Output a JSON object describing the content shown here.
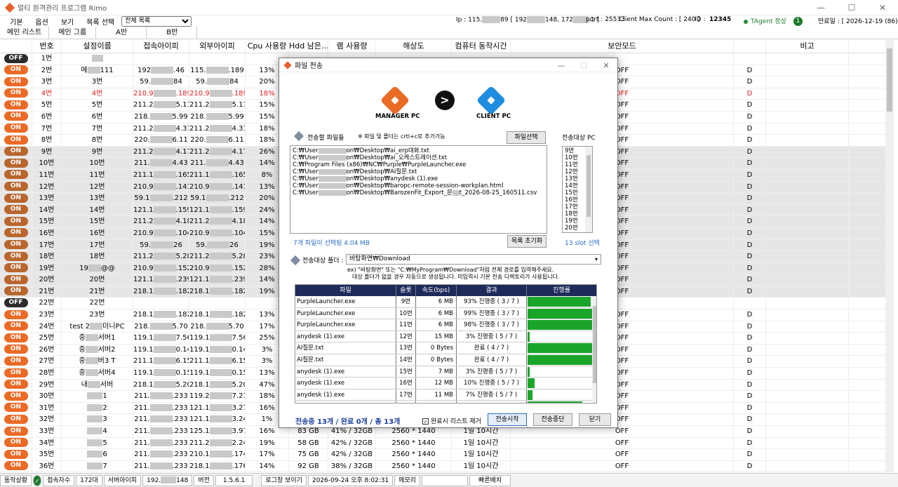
{
  "app": {
    "title": "멀티 원격관리 프로그램 Rimo",
    "win_min": "—",
    "win_max": "☐",
    "win_close": "✕"
  },
  "menu": {
    "items": [
      "기본",
      "옵션",
      "보기"
    ],
    "select_label": "목록 선택",
    "select_value": "전체 목록",
    "ip_prefix": "Ip : 115.",
    "ip_mid1": "89 [ 192",
    "ip_mid2": "148, 172",
    "ip_mid3": ".1 ]",
    "port": "port : 25533",
    "client_max": "Client Max Count : [ 240 ]",
    "id_label": "ID :",
    "id_value": "12345",
    "tagent": "TAgent 정상",
    "badge": "1",
    "expiry": "만료일 : [ 2026-12-19 (86) ]"
  },
  "tabs": [
    "메인 리스트",
    "메인 그룹",
    "A반",
    "B반"
  ],
  "grid": {
    "headers": [
      "",
      "번호",
      "설정이름",
      "접속아이피",
      "외부아이피",
      "Cpu 사용량",
      "Hdd 남은...",
      "램 사용량",
      "해상도",
      "컴퓨터 동작시간",
      "보안모드",
      "",
      "비고"
    ],
    "rows": [
      {
        "st": "OFF",
        "n": "1번",
        "name": "",
        "ip": "",
        "ext": "",
        "cpu": "",
        "hdd": "",
        "ram": "",
        "res": "",
        "time": "",
        "sec": "",
        "d": "",
        "sel": false,
        "red": false
      },
      {
        "st": "ON",
        "n": "2번",
        "name": "메",
        "nameb": "111",
        "ip": "192",
        "ipb": ".46",
        "ext": "115.",
        "extb": ".189",
        "cpu": "13%",
        "hdd": "",
        "ram": "",
        "res": "",
        "time": "",
        "sec": "OFF",
        "d": "D",
        "sel": false,
        "red": false
      },
      {
        "st": "ON",
        "n": "3번",
        "name": "3번",
        "ip": "59.",
        "ipb": "84",
        "ext": "59.",
        "extb": "84",
        "cpu": "20%",
        "hdd": "",
        "ram": "",
        "res": "",
        "time": "",
        "sec": "OFF",
        "d": "D",
        "sel": false,
        "red": false
      },
      {
        "st": "ON",
        "n": "4번",
        "name": "4번",
        "ip": "210.9",
        "ipb": ".189",
        "ext": "210.9",
        "extb": ".189",
        "cpu": "18%",
        "hdd": "",
        "ram": "",
        "res": "",
        "time": "",
        "sec": "OFF",
        "d": "D",
        "sel": false,
        "red": true
      },
      {
        "st": "ON",
        "n": "5번",
        "name": "5번",
        "ip": "211.2",
        "ipb": "5.114",
        "ext": "211.2",
        "extb": "5.114",
        "cpu": "15%",
        "hdd": "",
        "ram": "",
        "res": "",
        "time": "",
        "sec": "OFF",
        "d": "D",
        "sel": false,
        "red": false
      },
      {
        "st": "ON",
        "n": "6번",
        "name": "6번",
        "ip": "218.",
        "ipb": "5.99",
        "ext": "218.",
        "extb": "5.99",
        "cpu": "15%",
        "hdd": "",
        "ram": "",
        "res": "",
        "time": "",
        "sec": "OFF",
        "d": "D",
        "sel": false,
        "red": false
      },
      {
        "st": "ON",
        "n": "7번",
        "name": "7번",
        "ip": "211.2",
        "ipb": "4.31",
        "ext": "211.2",
        "extb": "4.31",
        "cpu": "18%",
        "hdd": "",
        "ram": "",
        "res": "",
        "time": "",
        "sec": "OFF",
        "d": "D",
        "sel": false,
        "red": false
      },
      {
        "st": "ON",
        "n": "8번",
        "name": "8번",
        "ip": "220.",
        "ipb": "6.11",
        "ext": "220.",
        "extb": "6.11",
        "cpu": "18%",
        "hdd": "",
        "ram": "",
        "res": "",
        "time": "",
        "sec": "OFF",
        "d": "D",
        "sel": false,
        "red": false
      },
      {
        "st": "ON",
        "n": "9번",
        "name": "9번",
        "ip": "211.2",
        "ipb": "4.179",
        "ext": "211.2",
        "extb": "4.179",
        "cpu": "26%",
        "hdd": "",
        "ram": "",
        "res": "",
        "time": "",
        "sec": "OFF",
        "d": "D",
        "sel": true,
        "red": false
      },
      {
        "st": "ON",
        "n": "10번",
        "name": "10번",
        "ip": "211.",
        "ipb": "4.43",
        "ext": "211.",
        "extb": "4.43",
        "cpu": "14%",
        "hdd": "",
        "ram": "",
        "res": "",
        "time": "",
        "sec": "OFF",
        "d": "D",
        "sel": true,
        "red": false
      },
      {
        "st": "ON",
        "n": "11번",
        "name": "11번",
        "ip": "211.1",
        "ipb": ".165",
        "ext": "211.1",
        "extb": ".165",
        "cpu": "8%",
        "hdd": "",
        "ram": "",
        "res": "",
        "time": "",
        "sec": "OFF",
        "d": "D",
        "sel": true,
        "red": false
      },
      {
        "st": "ON",
        "n": "12번",
        "name": "12번",
        "ip": "210.9",
        "ipb": ".141",
        "ext": "210.9",
        "extb": ".141",
        "cpu": "13%",
        "hdd": "",
        "ram": "",
        "res": "",
        "time": "",
        "sec": "OFF",
        "d": "D",
        "sel": true,
        "red": false
      },
      {
        "st": "ON",
        "n": "13번",
        "name": "13번",
        "ip": "59.1",
        "ipb": ".212",
        "ext": "59.1",
        "extb": ".212",
        "cpu": "20%",
        "hdd": "",
        "ram": "",
        "res": "",
        "time": "",
        "sec": "OFF",
        "d": "D",
        "sel": true,
        "red": false
      },
      {
        "st": "ON",
        "n": "14번",
        "name": "14번",
        "ip": "121.1",
        "ipb": ".159",
        "ext": "121.1",
        "extb": ".159",
        "cpu": "24%",
        "hdd": "",
        "ram": "",
        "res": "",
        "time": "",
        "sec": "OFF",
        "d": "D",
        "sel": true,
        "red": false
      },
      {
        "st": "ON",
        "n": "15번",
        "name": "15번",
        "ip": "211.2",
        "ipb": "4.184",
        "ext": "211.2",
        "extb": "4.184",
        "cpu": "14%",
        "hdd": "",
        "ram": "",
        "res": "",
        "time": "",
        "sec": "OFF",
        "d": "D",
        "sel": true,
        "red": false
      },
      {
        "st": "ON",
        "n": "16번",
        "name": "16번",
        "ip": "210.9",
        "ipb": ".104",
        "ext": "210.9",
        "extb": ".104",
        "cpu": "15%",
        "hdd": "",
        "ram": "",
        "res": "",
        "time": "",
        "sec": "OFF",
        "d": "D",
        "sel": true,
        "red": false
      },
      {
        "st": "ON",
        "n": "17번",
        "name": "17번",
        "ip": "59.",
        "ipb": "26",
        "ext": "59.",
        "extb": "26",
        "cpu": "19%",
        "hdd": "",
        "ram": "",
        "res": "",
        "time": "",
        "sec": "OFF",
        "d": "D",
        "sel": true,
        "red": false
      },
      {
        "st": "ON",
        "n": "18번",
        "name": "18번",
        "ip": "211.2",
        "ipb": "5.28",
        "ext": "211.2",
        "extb": "5.28",
        "cpu": "23%",
        "hdd": "",
        "ram": "",
        "res": "",
        "time": "",
        "sec": "OFF",
        "d": "D",
        "sel": true,
        "red": false
      },
      {
        "st": "ON",
        "n": "19번",
        "name": "19",
        "nameb": "@@",
        "ip": "210.9",
        "ipb": ".152",
        "ext": "210.9",
        "extb": ".152",
        "cpu": "28%",
        "hdd": "",
        "ram": "",
        "res": "",
        "time": "",
        "sec": "OFF",
        "d": "D",
        "sel": true,
        "red": false
      },
      {
        "st": "ON",
        "n": "20번",
        "name": "20번",
        "ip": "121.1",
        "ipb": ".239",
        "ext": "121.1",
        "extb": ".239",
        "cpu": "14%",
        "hdd": "",
        "ram": "",
        "res": "",
        "time": "",
        "sec": "OFF",
        "d": "D",
        "sel": true,
        "red": false
      },
      {
        "st": "ON",
        "n": "21번",
        "name": "21번",
        "ip": "218.1",
        "ipb": ".182",
        "ext": "218.1",
        "extb": ".182",
        "cpu": "19%",
        "hdd": "",
        "ram": "",
        "res": "",
        "time": "",
        "sec": "OFF",
        "d": "D",
        "sel": true,
        "red": false
      },
      {
        "st": "OFF",
        "n": "22번",
        "name": "22번",
        "ip": "",
        "ext": "",
        "cpu": "",
        "hdd": "",
        "ram": "",
        "res": "",
        "time": "",
        "sec": "",
        "d": "",
        "sel": false,
        "red": false
      },
      {
        "st": "ON",
        "n": "23번",
        "name": "23번",
        "ip": "218.1",
        "ipb": ".182",
        "ext": "218.1",
        "extb": ".182",
        "cpu": "13%",
        "hdd": "",
        "ram": "",
        "res": "",
        "time": "",
        "sec": "OFF",
        "d": "D",
        "sel": false,
        "red": false
      },
      {
        "st": "ON",
        "n": "24번",
        "name": "test 2",
        "nameb": "미니PC",
        "ip": "218.",
        "ipb": "5.70",
        "ext": "218.",
        "extb": "5.70",
        "cpu": "17%",
        "hdd": "",
        "ram": "",
        "res": "",
        "time": "",
        "sec": "OFF",
        "d": "D",
        "sel": false,
        "red": false
      },
      {
        "st": "ON",
        "n": "25번",
        "name": "중",
        "nameb": "서버1",
        "ip": "119.1",
        "ipb": "7.56",
        "ext": "119.1",
        "extb": "7.56",
        "cpu": "25%",
        "hdd": "",
        "ram": "",
        "res": "",
        "time": "",
        "sec": "OFF",
        "d": "D",
        "sel": false,
        "red": false
      },
      {
        "st": "ON",
        "n": "26번",
        "name": "중",
        "nameb": "서버2",
        "ip": "119.1",
        "ipb": "0.149",
        "ext": "119.1",
        "extb": "0.149",
        "cpu": "3%",
        "hdd": "",
        "ram": "",
        "res": "",
        "time": "",
        "sec": "OFF",
        "d": "D",
        "sel": false,
        "red": false
      },
      {
        "st": "ON",
        "n": "27번",
        "name": "중",
        "nameb": "버3 T",
        "ip": "211.1",
        "ipb": "6.154",
        "ext": "211.1",
        "extb": "6.154",
        "cpu": "3%",
        "hdd": "",
        "ram": "",
        "res": "",
        "time": "",
        "sec": "OFF",
        "d": "D",
        "sel": false,
        "red": false
      },
      {
        "st": "ON",
        "n": "28번",
        "name": "중",
        "nameb": "서버4",
        "ip": "119.1",
        "ipb": "0.156",
        "ext": "119.1",
        "extb": "0.156",
        "cpu": "13%",
        "hdd": "",
        "ram": "",
        "res": "",
        "time": "",
        "sec": "OFF",
        "d": "D",
        "sel": false,
        "red": false
      },
      {
        "st": "ON",
        "n": "29번",
        "name": "내",
        "nameb": "서버",
        "ip": "218.1",
        "ipb": "5.203",
        "ext": "218.1",
        "extb": "5.203",
        "cpu": "47%",
        "hdd": "",
        "ram": "",
        "res": "",
        "time": "",
        "sec": "OFF",
        "d": "D",
        "sel": false,
        "red": false
      },
      {
        "st": "ON",
        "n": "30번",
        "name": "",
        "nameb": "1",
        "ip": "211.",
        "ipb": ".233",
        "ext": "119.2",
        "extb": "7.217",
        "cpu": "18%",
        "hdd": "",
        "ram": "",
        "res": "",
        "time": "",
        "sec": "OFF",
        "d": "D",
        "sel": false,
        "red": false
      },
      {
        "st": "ON",
        "n": "31번",
        "name": "",
        "nameb": "2",
        "ip": "211.",
        "ipb": ".233",
        "ext": "121.1",
        "extb": "3.27",
        "cpu": "16%",
        "hdd": "",
        "ram": "",
        "res": "",
        "time": "",
        "sec": "OFF",
        "d": "D",
        "sel": false,
        "red": false
      },
      {
        "st": "ON",
        "n": "32번",
        "name": "",
        "nameb": "3",
        "ip": "211.",
        "ipb": ".233",
        "ext": "121.1",
        "extb": "3.240",
        "cpu": "1%",
        "hdd": "",
        "ram": "",
        "res": "",
        "time": "",
        "sec": "OFF",
        "d": "D",
        "sel": false,
        "red": false
      },
      {
        "st": "ON",
        "n": "33번",
        "name": "",
        "nameb": "4",
        "ip": "211.",
        "ipb": ".233",
        "ext": "125.1",
        "extb": "3.97",
        "cpu": "16%",
        "hdd": "83 GB",
        "ram": "41% / 32GB",
        "res": "2560 * 1440",
        "time": "1일 10시간",
        "sec": "OFF",
        "d": "D",
        "sel": false,
        "red": false
      },
      {
        "st": "ON",
        "n": "34번",
        "name": "",
        "nameb": "5",
        "ip": "211.",
        "ipb": ".233",
        "ext": "211.2",
        "extb": "2.245",
        "cpu": "19%",
        "hdd": "58 GB",
        "ram": "42% / 32GB",
        "res": "2560 * 1440",
        "time": "1일 10시간",
        "sec": "OFF",
        "d": "D",
        "sel": false,
        "red": false
      },
      {
        "st": "ON",
        "n": "35번",
        "name": "",
        "nameb": "6",
        "ip": "211.",
        "ipb": ".233",
        "ext": "210.1",
        "extb": ".174",
        "cpu": "17%",
        "hdd": "75 GB",
        "ram": "42% / 32GB",
        "res": "2560 * 1440",
        "time": "1일 10시간",
        "sec": "OFF",
        "d": "D",
        "sel": false,
        "red": false
      },
      {
        "st": "ON",
        "n": "36번",
        "name": "",
        "nameb": "7",
        "ip": "211.",
        "ipb": ".233",
        "ext": "218.1",
        "extb": ".176",
        "cpu": "14%",
        "hdd": "92 GB",
        "ram": "38% / 32GB",
        "res": "2560 * 1440",
        "time": "1일 10시간",
        "sec": "OFF",
        "d": "D",
        "sel": false,
        "red": false
      }
    ]
  },
  "dialog": {
    "title": "파일 전송",
    "win_min": "—",
    "win_max": "☐",
    "win_close": "✕",
    "manager_label": "MANAGER PC",
    "client_label": "CLIENT PC",
    "arrow": ">",
    "files_label": "전송할 파일들",
    "files_hint": "※ 파일 및 폴더는 crtl+c로 추가가능",
    "select_files_btn": "파일선택",
    "target_pc_label": "전송대상 PC",
    "files": [
      "C:₩User",
      "C:₩User",
      "C:₩Program Files (x86)₩NC₩Purple₩PurpleLauncher.exe",
      "C:₩User",
      "C:₩User",
      "C:₩User",
      "C:₩User"
    ],
    "files_suffix": [
      "on₩Desktop₩ai_erp대화.txt",
      "on₩Desktop₩ai_오케스트레이션.txt",
      "",
      "on₩Desktop₩AI질문.txt",
      "on₩Desktop₩anydesk (1).exe",
      "on₩Desktop₩baropc-remote-session-workplan.html",
      "on₩Desktop₩BarozenFit_Export_문"
    ],
    "file_last_tail": "t_2026-08-25_160511.csv",
    "target_pcs": [
      "9번",
      "10번",
      "11번",
      "12번",
      "13번",
      "14번",
      "15번",
      "16번",
      "17번",
      "18번",
      "19번",
      "20번"
    ],
    "selected_summary": "7개 파일이 선택됨 4.04 MB",
    "reset_btn": "목록 초기화",
    "slot_summary": "13 slot 선택",
    "folder_label": "전송대상 폴더 :",
    "folder_value": "바탕화면₩Download",
    "folder_hint1": "ex) \"바탕화면\" 또는 \"C:₩MyProgram₩Download\"처럼 전체 경로를 입력해주세요.",
    "folder_hint2": "대상 폴더가 없을 경우 자동으로 생성됩니다. 미입력시 기본 전송 디렉토리가 사용됩니다.",
    "table_headers": [
      "파일",
      "슬롯",
      "속도(bps)",
      "결과",
      "진행률"
    ],
    "transfers": [
      {
        "file": "PurpleLauncher.exe",
        "slot": "9번",
        "speed": "6 MB",
        "result": "93% 진행중 ( 3 / 7 )",
        "progress": 0.93
      },
      {
        "file": "PurpleLauncher.exe",
        "slot": "10번",
        "speed": "6 MB",
        "result": "99% 진행중 ( 3 / 7 )",
        "progress": 0.99
      },
      {
        "file": "PurpleLauncher.exe",
        "slot": "11번",
        "speed": "6 MB",
        "result": "98% 진행중 ( 3 / 7 )",
        "progress": 0.98
      },
      {
        "file": "anydesk (1).exe",
        "slot": "12번",
        "speed": "15 MB",
        "result": "3% 진행중 ( 5 / 7 )",
        "progress": 0.03
      },
      {
        "file": "AI질문.txt",
        "slot": "13번",
        "speed": "0 Bytes",
        "result": "완료 ( 4 / 7 )",
        "progress": 1.0
      },
      {
        "file": "AI질문.txt",
        "slot": "14번",
        "speed": "0 Bytes",
        "result": "완료 ( 4 / 7 )",
        "progress": 1.0
      },
      {
        "file": "anydesk (1).exe",
        "slot": "15번",
        "speed": "7 MB",
        "result": "3% 진행중 ( 5 / 7 )",
        "progress": 0.03
      },
      {
        "file": "anydesk (1).exe",
        "slot": "16번",
        "speed": "12 MB",
        "result": "10% 진행중 ( 5 / 7 )",
        "progress": 0.1
      },
      {
        "file": "anydesk (1).exe",
        "slot": "17번",
        "speed": "11 MB",
        "result": "7% 진행중 ( 5 / 7 )",
        "progress": 0.07
      },
      {
        "file": "",
        "slot": "",
        "speed": "",
        "result": "",
        "progress": 0.8
      }
    ],
    "summary": "전송중 13개 / 완료 0개 / 총 13개",
    "remove_on_done": "완료시 리스트 제거",
    "start_btn": "전송시작",
    "stop_btn": "전송중단",
    "close_btn": "닫기"
  },
  "status": {
    "state_label": "동작상황",
    "conn_label": "접속자수",
    "conn_value": "172대",
    "server_ip_label": "서버아이피",
    "server_ip_a": "192.",
    "server_ip_b": "148",
    "version_label": "버전",
    "version_value": "1.5.6.1",
    "log_btn": "로그창 보이기",
    "datetime": "2026-09-24 오후 8:02:31",
    "memo": "메모리",
    "fast": "빠른배치"
  },
  "colors": {
    "on": "#ea6a26",
    "off": "#2b2b2b",
    "progress": "#1aa52a",
    "table_header": "#1e2a5a",
    "summary": "#1d3fa0",
    "link": "#2a6fc7"
  }
}
